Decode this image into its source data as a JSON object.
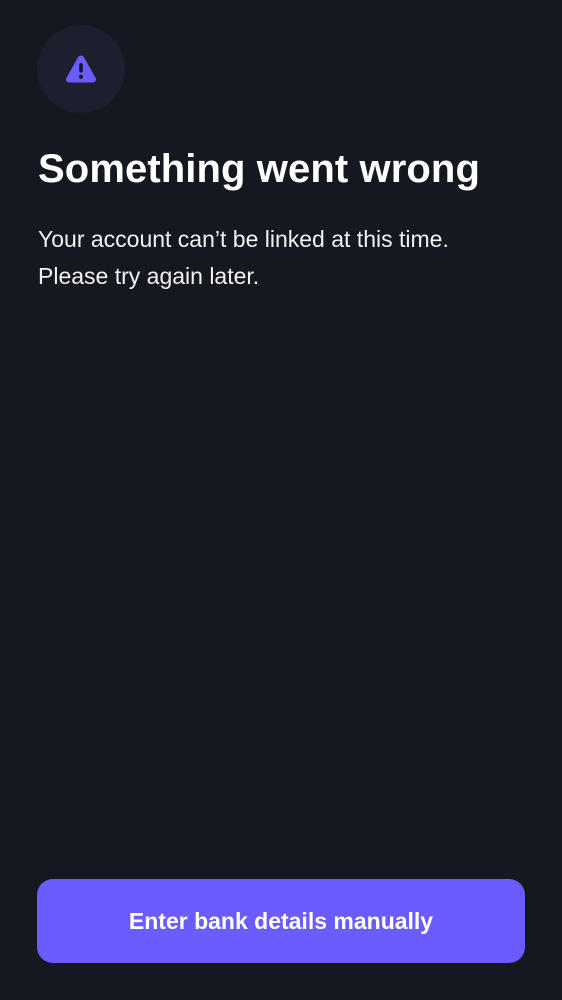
{
  "header": {
    "icon": "warning-triangle-icon",
    "icon_color": "#6a5cff",
    "icon_bg_color": "#1d1e2e"
  },
  "error": {
    "title": "Something went wrong",
    "line1": "Your account can’t be linked at this time.",
    "line2": "Please try again later."
  },
  "actions": {
    "primary_label": "Enter bank details manually",
    "primary_color": "#6a5cff"
  },
  "theme": {
    "background": "#16181f",
    "text": "#ffffff"
  }
}
